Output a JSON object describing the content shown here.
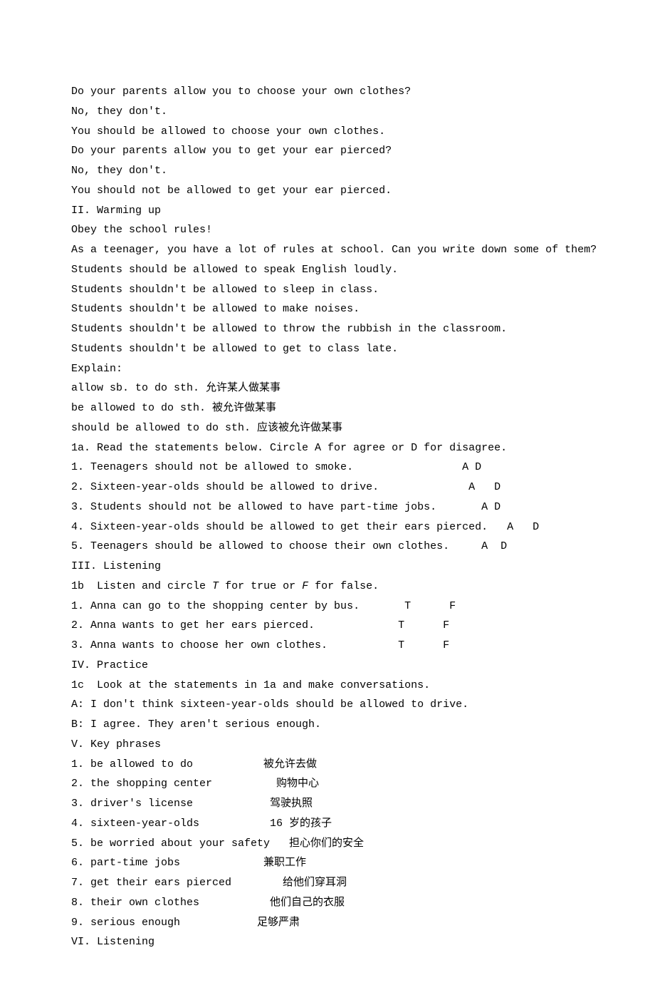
{
  "lines": [
    "Do your parents allow you to choose your own clothes?",
    "No, they don't.",
    "You should be allowed to choose your own clothes.",
    "Do your parents allow you to get your ear pierced?",
    "No, they don't.",
    "You should not be allowed to get your ear pierced.",
    "II. Warming up",
    "Obey the school rules!",
    "As a teenager, you have a lot of rules at school. Can you write down some of them?",
    "Students should be allowed to speak English loudly.",
    "Students shouldn't be allowed to sleep in class.",
    "Students shouldn't be allowed to make noises.",
    "Students shouldn't be allowed to throw the rubbish in the classroom.",
    "Students shouldn't be allowed to get to class late.",
    "Explain:",
    "allow sb. to do sth. 允许某人做某事",
    "be allowed to do sth. 被允许做某事",
    "should be allowed to do sth. 应该被允许做某事",
    "1a. Read the statements below. Circle A for agree or D for disagree.",
    "1. Teenagers should not be allowed to smoke.                 A D",
    "2. Sixteen-year-olds should be allowed to drive.              A   D",
    "3. Students should not be allowed to have part-time jobs.       A D",
    "4. Sixteen-year-olds should be allowed to get their ears pierced.   A   D",
    "5. Teenagers should be allowed to choose their own clothes.     A  D",
    "III. Listening"
  ],
  "line_1b": {
    "prefix": "1b  Listen and circle ",
    "t": "T",
    "mid1": " for true or ",
    "f": "F",
    "suffix": " for false."
  },
  "lines2": [
    "1. Anna can go to the shopping center by bus.       T      F",
    "2. Anna wants to get her ears pierced.             T      F",
    "3. Anna wants to choose her own clothes.           T      F",
    "IV. Practice",
    "1c  Look at the statements in 1a and make conversations.",
    "A: I don't think sixteen-year-olds should be allowed to drive.",
    "B: I agree. They aren't serious enough.",
    "V. Key phrases",
    "1. be allowed to do           被允许去做",
    "2. the shopping center          购物中心",
    "3. driver's license            驾驶执照",
    "4. sixteen-year-olds           16 岁的孩子",
    "5. be worried about your safety   担心你们的安全",
    "6. part-time jobs             兼职工作",
    "7. get their ears pierced        给他们穿耳洞",
    "8. their own clothes           他们自己的衣服",
    "9. serious enough            足够严肃",
    "VI. Listening"
  ]
}
